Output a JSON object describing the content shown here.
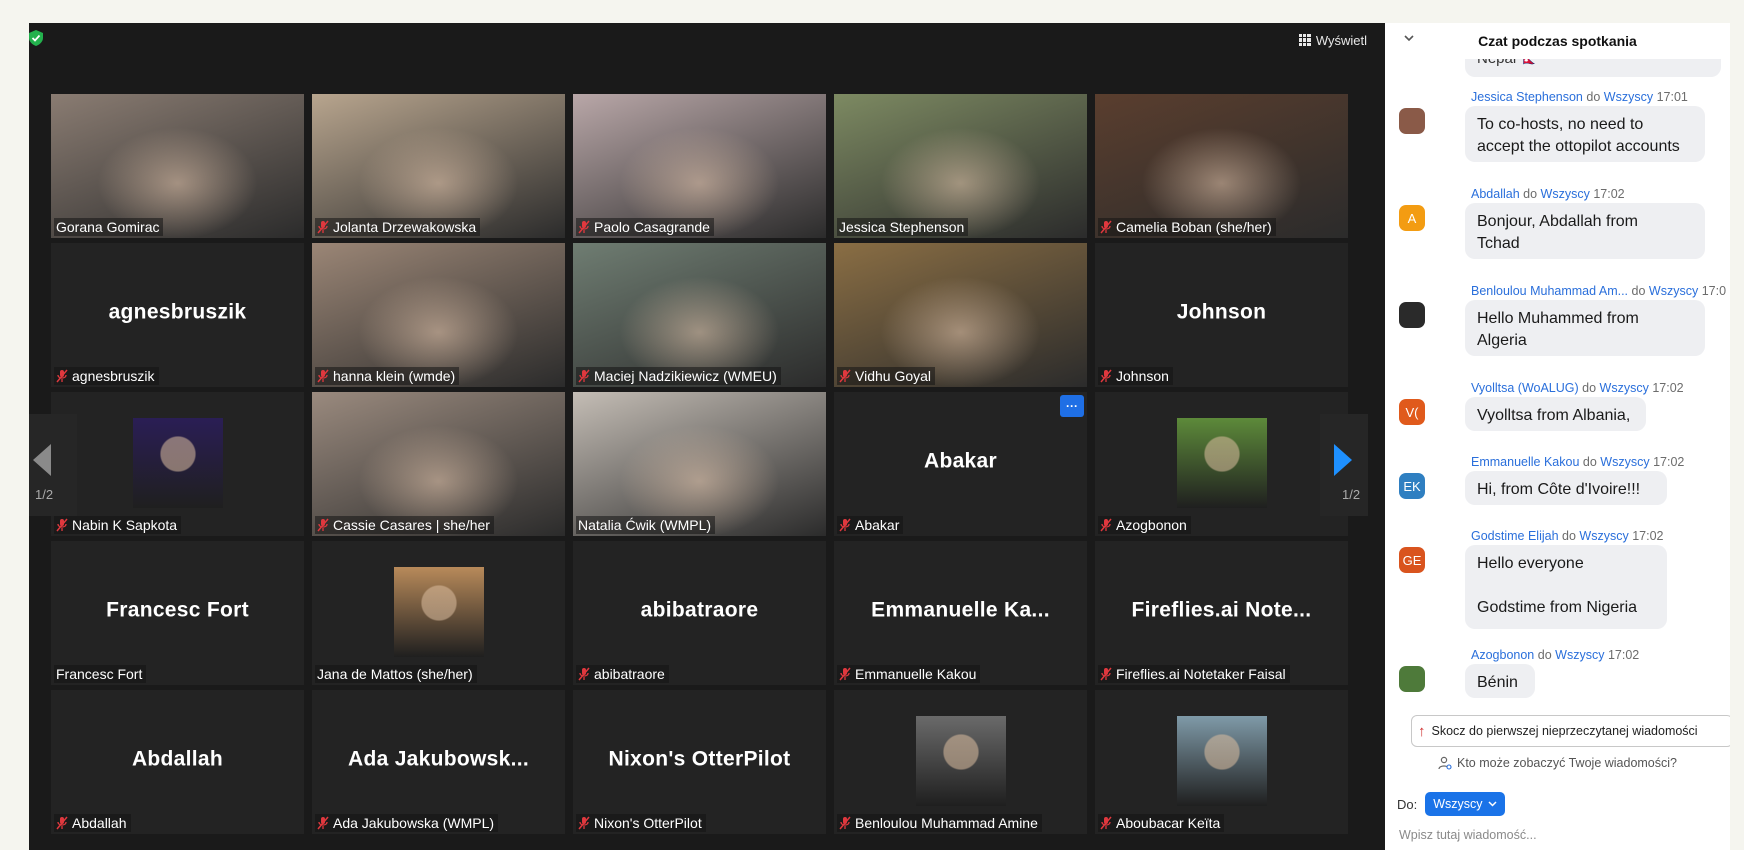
{
  "toolbar": {
    "view_label": "Wyświetl"
  },
  "pagination": {
    "left_page": "1/2",
    "right_page": "1/2"
  },
  "participants": [
    {
      "name": "Gorana Gomirac",
      "muted": false,
      "type": "video",
      "bg": "#8a7c72"
    },
    {
      "name": "Jolanta Drzewakowska",
      "muted": true,
      "type": "video",
      "bg": "#b8a58e"
    },
    {
      "name": "Paolo Casagrande",
      "muted": true,
      "type": "video",
      "bg": "#b9a7a8"
    },
    {
      "name": "Jessica Stephenson",
      "muted": false,
      "type": "video",
      "bg": "#7d8a62",
      "active": true
    },
    {
      "name": "Camelia Boban (she/her)",
      "muted": true,
      "type": "video",
      "bg": "#5a3e2e"
    },
    {
      "name": "agnesbruszik",
      "display": "agnesbruszik",
      "muted": true,
      "type": "name"
    },
    {
      "name": "hanna klein (wmde)",
      "muted": true,
      "type": "video",
      "bg": "#9b8676"
    },
    {
      "name": "Maciej Nadzikiewicz (WMEU)",
      "muted": true,
      "type": "video",
      "bg": "#6f7d72"
    },
    {
      "name": "Vidhu Goyal",
      "muted": true,
      "type": "video",
      "bg": "#8a6e44"
    },
    {
      "name": "Johnson",
      "display": "Johnson",
      "muted": true,
      "type": "name"
    },
    {
      "name": "Nabin K Sapkota",
      "muted": true,
      "type": "avatar",
      "bg": "#2a1e55"
    },
    {
      "name": "Cassie Casares | she/her",
      "muted": true,
      "type": "video",
      "bg": "#9a8a7e"
    },
    {
      "name": "Natalia Ćwik (WMPL)",
      "muted": false,
      "type": "video",
      "bg": "#c4bdb5"
    },
    {
      "name": "Abakar",
      "display": "Abakar",
      "muted": true,
      "type": "name",
      "more": true
    },
    {
      "name": "Azogbonon",
      "muted": true,
      "type": "avatar",
      "bg": "#5d8a3a"
    },
    {
      "name": "Francesc Fort",
      "display": "Francesc Fort",
      "muted": false,
      "type": "name"
    },
    {
      "name": "Jana de Mattos (she/her)",
      "muted": false,
      "type": "avatar",
      "bg": "#b88a5a"
    },
    {
      "name": "abibatraore",
      "display": "abibatraore",
      "muted": true,
      "type": "name"
    },
    {
      "name": "Emmanuelle Kakou",
      "display": "Emmanuelle  Ka...",
      "muted": true,
      "type": "name"
    },
    {
      "name": "Fireflies.ai Notetaker Faisal",
      "display": "Fireflies.ai  Note...",
      "muted": true,
      "type": "name"
    },
    {
      "name": "Abdallah",
      "display": "Abdallah",
      "muted": true,
      "type": "name"
    },
    {
      "name": "Ada Jakubowska (WMPL)",
      "display": "Ada  Jakubowsk...",
      "muted": true,
      "type": "name"
    },
    {
      "name": "Nixon's OtterPilot",
      "display": "Nixon's OtterPilot",
      "muted": true,
      "type": "name"
    },
    {
      "name": "Benloulou Muhammad Amine",
      "muted": true,
      "type": "avatar",
      "bg": "#6a6a6a"
    },
    {
      "name": "Aboubacar Keïta",
      "muted": true,
      "type": "avatar",
      "bg": "#7f9aa8"
    }
  ],
  "chat": {
    "title": "Czat podczas spotkania",
    "prev_bubble_text": "Nepal 🇳🇵",
    "join_word": "do",
    "messages": [
      {
        "from": "Jessica Stephenson",
        "to": "Wszyscy",
        "time": "17:01",
        "text": "To co-hosts, no need to\naccept the ottopilot accounts",
        "avatar_text": "",
        "avatar_color": "#8a5a48"
      },
      {
        "from": "Abdallah",
        "to": "Wszyscy",
        "time": "17:02",
        "text": "Bonjour, Abdallah from\nTchad",
        "avatar_text": "A",
        "avatar_color": "#f39c12"
      },
      {
        "from": "Benloulou Muhammad Am...",
        "to": "Wszyscy",
        "time": "17:0",
        "text": "Hello Muhammed from\nAlgeria",
        "avatar_text": "",
        "avatar_color": "#2a2a2a"
      },
      {
        "from": "Vyolltsa (WoALUG)",
        "to": "Wszyscy",
        "time": "17:02",
        "text": "Vyolltsa from Albania,",
        "avatar_text": "V(",
        "avatar_color": "#e05a1c"
      },
      {
        "from": "Emmanuelle Kakou",
        "to": "Wszyscy",
        "time": "17:02",
        "text": "Hi, from Côte d'Ivoire!!!",
        "avatar_text": "EK",
        "avatar_color": "#2f7fc1"
      },
      {
        "from": "Godstime Elijah",
        "to": "Wszyscy",
        "time": "17:02",
        "text": "Hello everyone\n\nGodstime from Nigeria",
        "avatar_text": "GE",
        "avatar_color": "#d9541e"
      },
      {
        "from": "Azogbonon",
        "to": "Wszyscy",
        "time": "17:02",
        "text": "Bénin",
        "avatar_text": "",
        "avatar_color": "#4e7a3a"
      }
    ],
    "jump_label": "Skocz do pierwszej nieprzeczytanej wiadomości",
    "who_sees_label": "Kto może zobaczyć Twoje wiadomości?",
    "to_label": "Do:",
    "to_value": "Wszyscy",
    "input_placeholder": "Wpisz tutaj wiadomość..."
  },
  "colors": {
    "active_speaker": "#c5e86c",
    "mute_red": "#e0383e",
    "link_blue": "#2a6fdb",
    "accent_blue": "#1a73e8"
  }
}
